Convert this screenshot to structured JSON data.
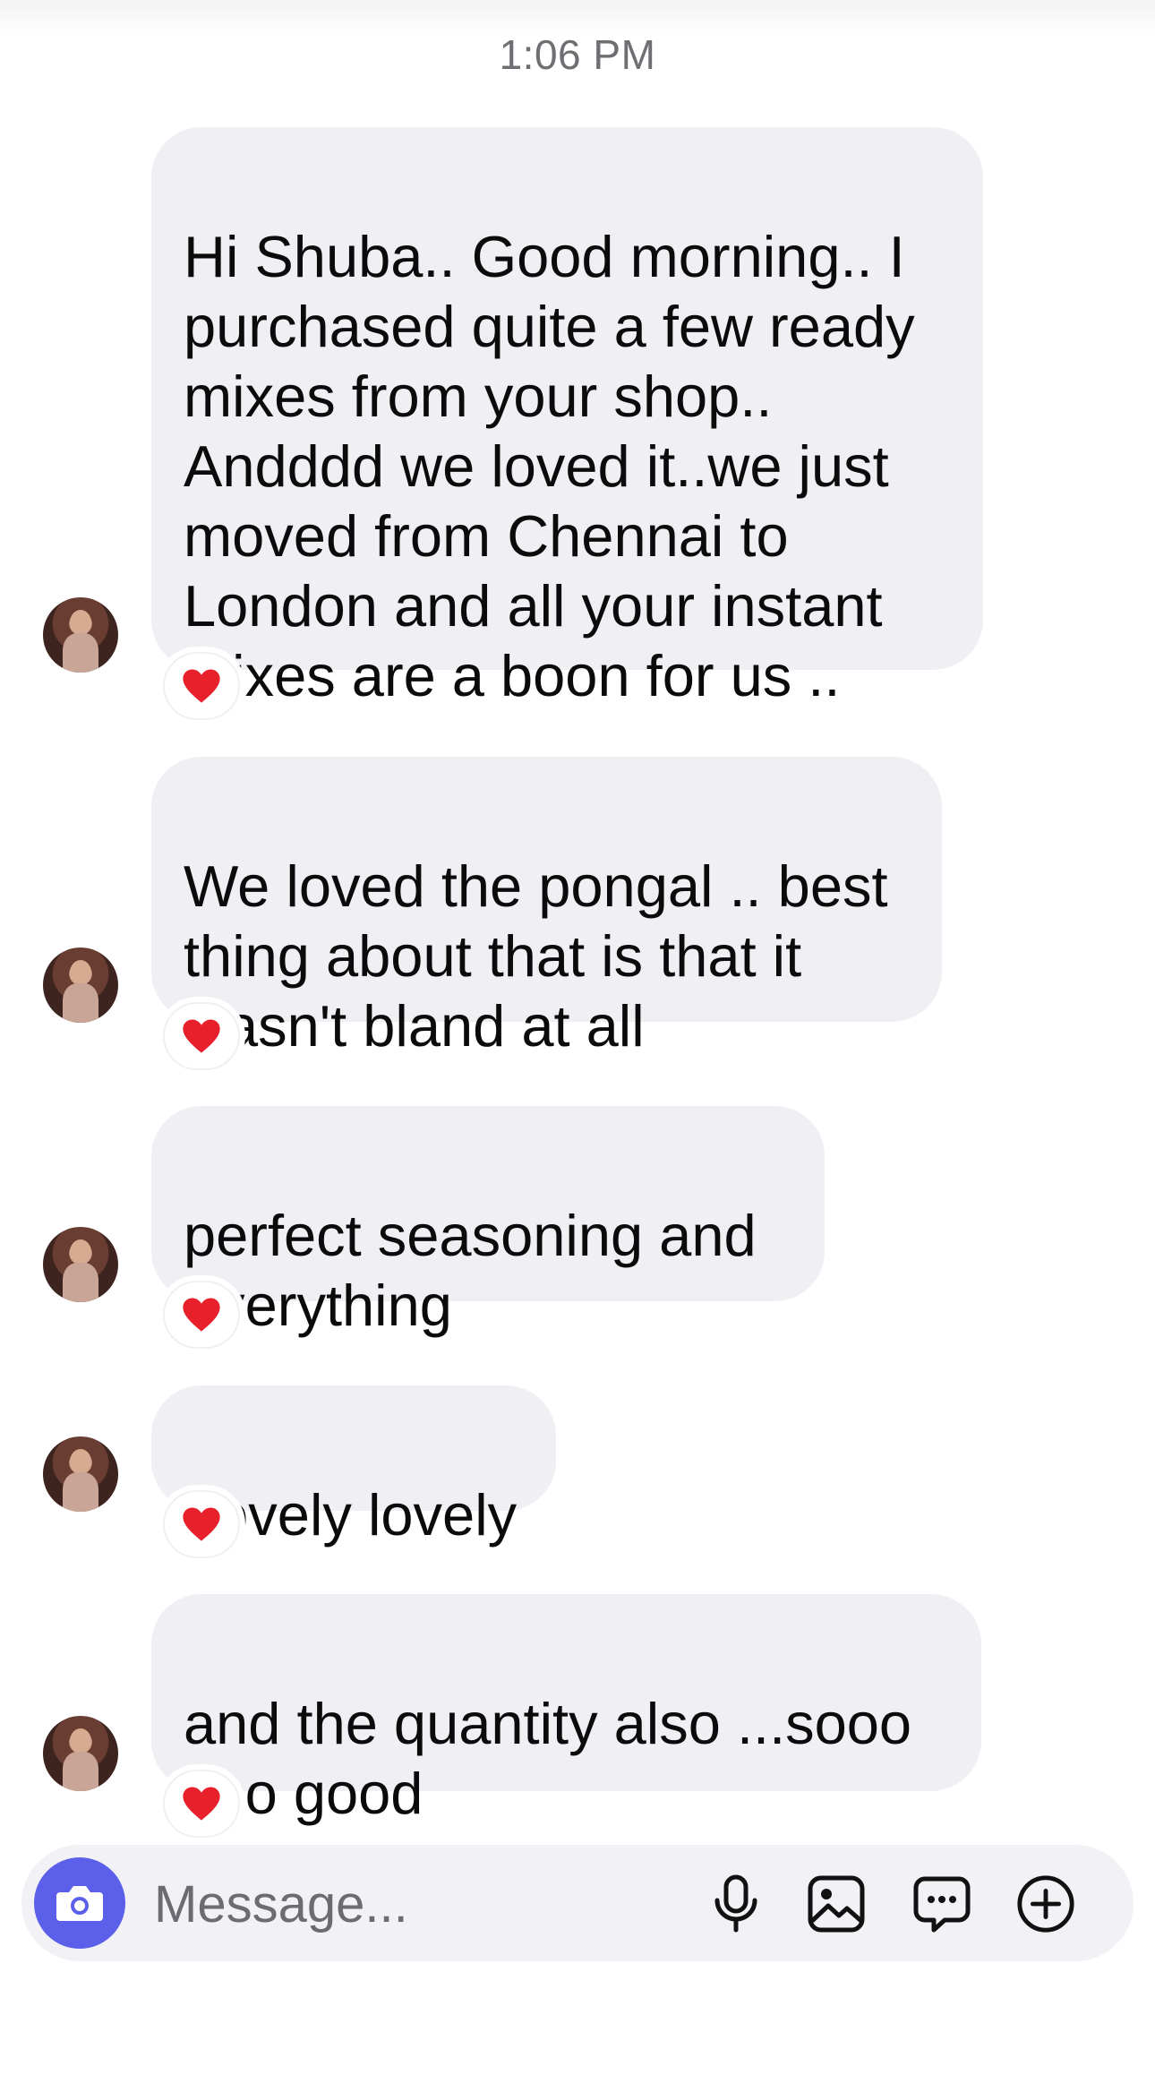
{
  "timestamp": "1:06 PM",
  "messages": [
    {
      "text": "Hi Shuba.. Good morning.. I\npurchased quite a few ready\nmixes from your shop..\nAndddd we loved it..we just\nmoved from Chennai to\nLondon and all your instant\nmixes are a boon for us ..",
      "reaction": "heart"
    },
    {
      "text": "We loved the pongal .. best\nthing about that is that it\nwasn't bland at all",
      "reaction": "heart"
    },
    {
      "text": "perfect seasoning and\neverything",
      "reaction": "heart"
    },
    {
      "text": "Lovely lovely",
      "reaction": "heart"
    },
    {
      "text": "and the quantity also ...sooo\nsoo good",
      "reaction": "heart"
    }
  ],
  "composer": {
    "placeholder": "Message...",
    "icons": [
      "camera-icon",
      "microphone-icon",
      "image-icon",
      "sticker-message-icon",
      "plus-circle-icon"
    ]
  },
  "colors": {
    "bubble": "#efeff4",
    "camera_button": "#5b5fe9",
    "heart": "#e8202c"
  }
}
